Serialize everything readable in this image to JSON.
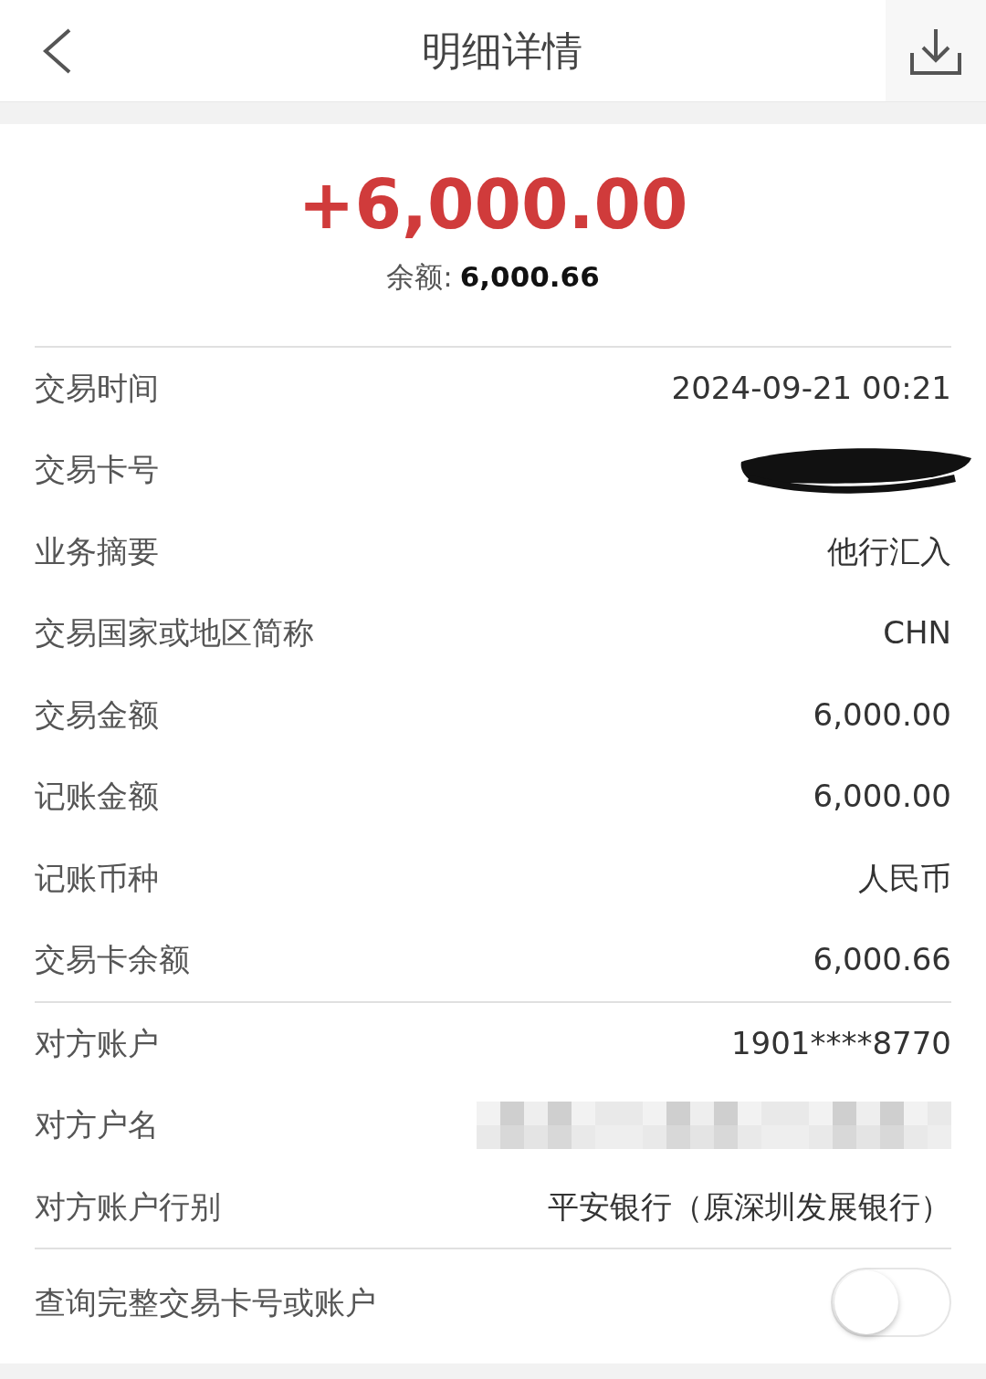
{
  "header": {
    "title": "明细详情"
  },
  "summary": {
    "amount": "+6,000.00",
    "balance_label": "余额:",
    "balance": "6,000.66"
  },
  "sections": [
    {
      "rows": [
        {
          "kind": "text",
          "label": "交易时间",
          "value": "2024-09-21 00:21"
        },
        {
          "kind": "scribble",
          "label": "交易卡号"
        },
        {
          "kind": "text",
          "label": "业务摘要",
          "value": "他行汇入"
        },
        {
          "kind": "text",
          "label": "交易国家或地区简称",
          "value": "CHN"
        },
        {
          "kind": "text",
          "label": "交易金额",
          "value": "6,000.00"
        },
        {
          "kind": "text",
          "label": "记账金额",
          "value": "6,000.00"
        },
        {
          "kind": "text",
          "label": "记账币种",
          "value": "人民币"
        },
        {
          "kind": "text",
          "label": "交易卡余额",
          "value": "6,000.66"
        }
      ]
    },
    {
      "rows": [
        {
          "kind": "text",
          "label": "对方账户",
          "value": "1901****8770"
        },
        {
          "kind": "mosaic",
          "label": "对方户名"
        },
        {
          "kind": "text",
          "label": "对方账户行别",
          "value": "平安银行（原深圳发展银行）"
        }
      ]
    }
  ],
  "toggle": {
    "label": "查询完整交易卡号或账户",
    "on": false
  }
}
